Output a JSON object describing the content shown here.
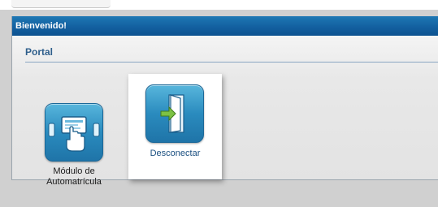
{
  "panel": {
    "header_title": "Bienvenido!",
    "section_title": "Portal"
  },
  "tiles": [
    {
      "label_line1": "Módulo de",
      "label_line2": "Automatrícula",
      "icon": "kiosk-touch-icon"
    },
    {
      "label": "Desconectar",
      "icon": "exit-door-icon"
    }
  ],
  "colors": {
    "header_blue": "#1360a0",
    "section_title": "#2f5f8c",
    "icon_blue": "#2a8bbe",
    "panel_bg": "#e6e6e6"
  }
}
